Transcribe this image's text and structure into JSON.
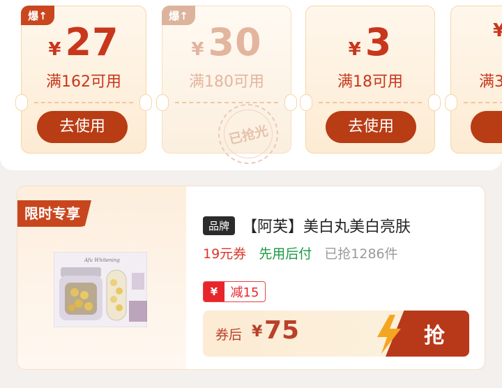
{
  "coupons": [
    {
      "hot_label": "爆↑",
      "currency": "¥",
      "amount": "27",
      "condition": "满162可用",
      "action": "去使用",
      "state": "available"
    },
    {
      "hot_label": "爆↑",
      "currency": "¥",
      "amount": "30",
      "condition": "满180可用",
      "state": "sold_out",
      "stamp": "已抢光"
    },
    {
      "currency": "¥",
      "amount": "3",
      "condition": "满18可用",
      "action": "去使用",
      "state": "available"
    },
    {
      "currency": "¥",
      "amount": "",
      "condition": "满3",
      "action": "去",
      "state": "available"
    }
  ],
  "product": {
    "limited_tag": "限时专享",
    "image_caption": "Afu Whitening",
    "brand_tag": "品牌",
    "title": "【阿芙】美白丸美白亮肤",
    "coupon_text": "19元券",
    "pay_later": "先用后付",
    "sold_count": "已抢1286件",
    "discount_icon": "¥",
    "discount_label": "减15",
    "after_coupon_label": "券后",
    "price_currency": "¥",
    "price": "75",
    "buy_label": "抢"
  },
  "colors": {
    "accent": "#b83c14",
    "price_red": "#c8361c",
    "green": "#1d9944"
  }
}
